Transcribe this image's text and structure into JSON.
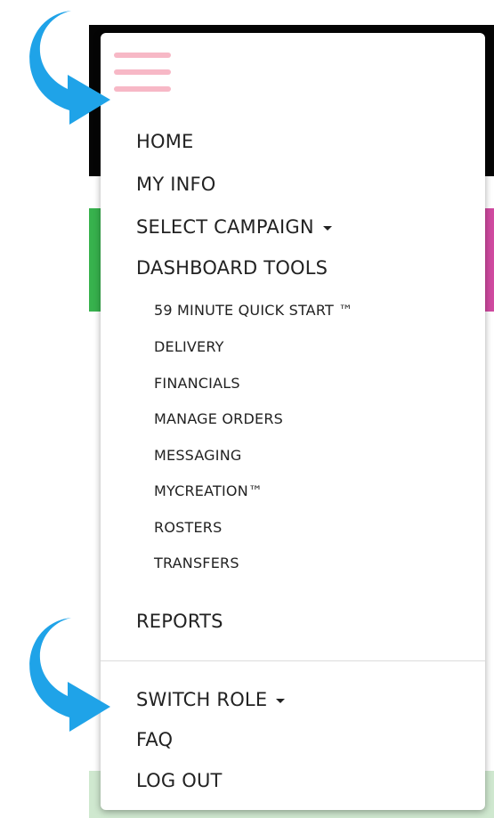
{
  "menu": {
    "toggle_icon": "hamburger-icon",
    "items": [
      {
        "label": "HOME"
      },
      {
        "label": "MY INFO"
      },
      {
        "label": "SELECT CAMPAIGN",
        "dropdown": true
      },
      {
        "label": "DASHBOARD TOOLS"
      }
    ],
    "dashboard_tools": [
      {
        "label": "59 MINUTE QUICK START ™"
      },
      {
        "label": "DELIVERY"
      },
      {
        "label": "FINANCIALS"
      },
      {
        "label": "MANAGE ORDERS"
      },
      {
        "label": "MESSAGING"
      },
      {
        "label": "MYCREATION™"
      },
      {
        "label": "ROSTERS"
      },
      {
        "label": "TRANSFERS"
      }
    ],
    "reports": {
      "label": "REPORTS"
    },
    "footer_items": [
      {
        "label": "SWITCH ROLE",
        "dropdown": true
      },
      {
        "label": "FAQ"
      },
      {
        "label": "LOG OUT"
      }
    ]
  },
  "annotations": {
    "arrow_color": "#1fa3e8",
    "accent_color": "#f7b8c6"
  }
}
